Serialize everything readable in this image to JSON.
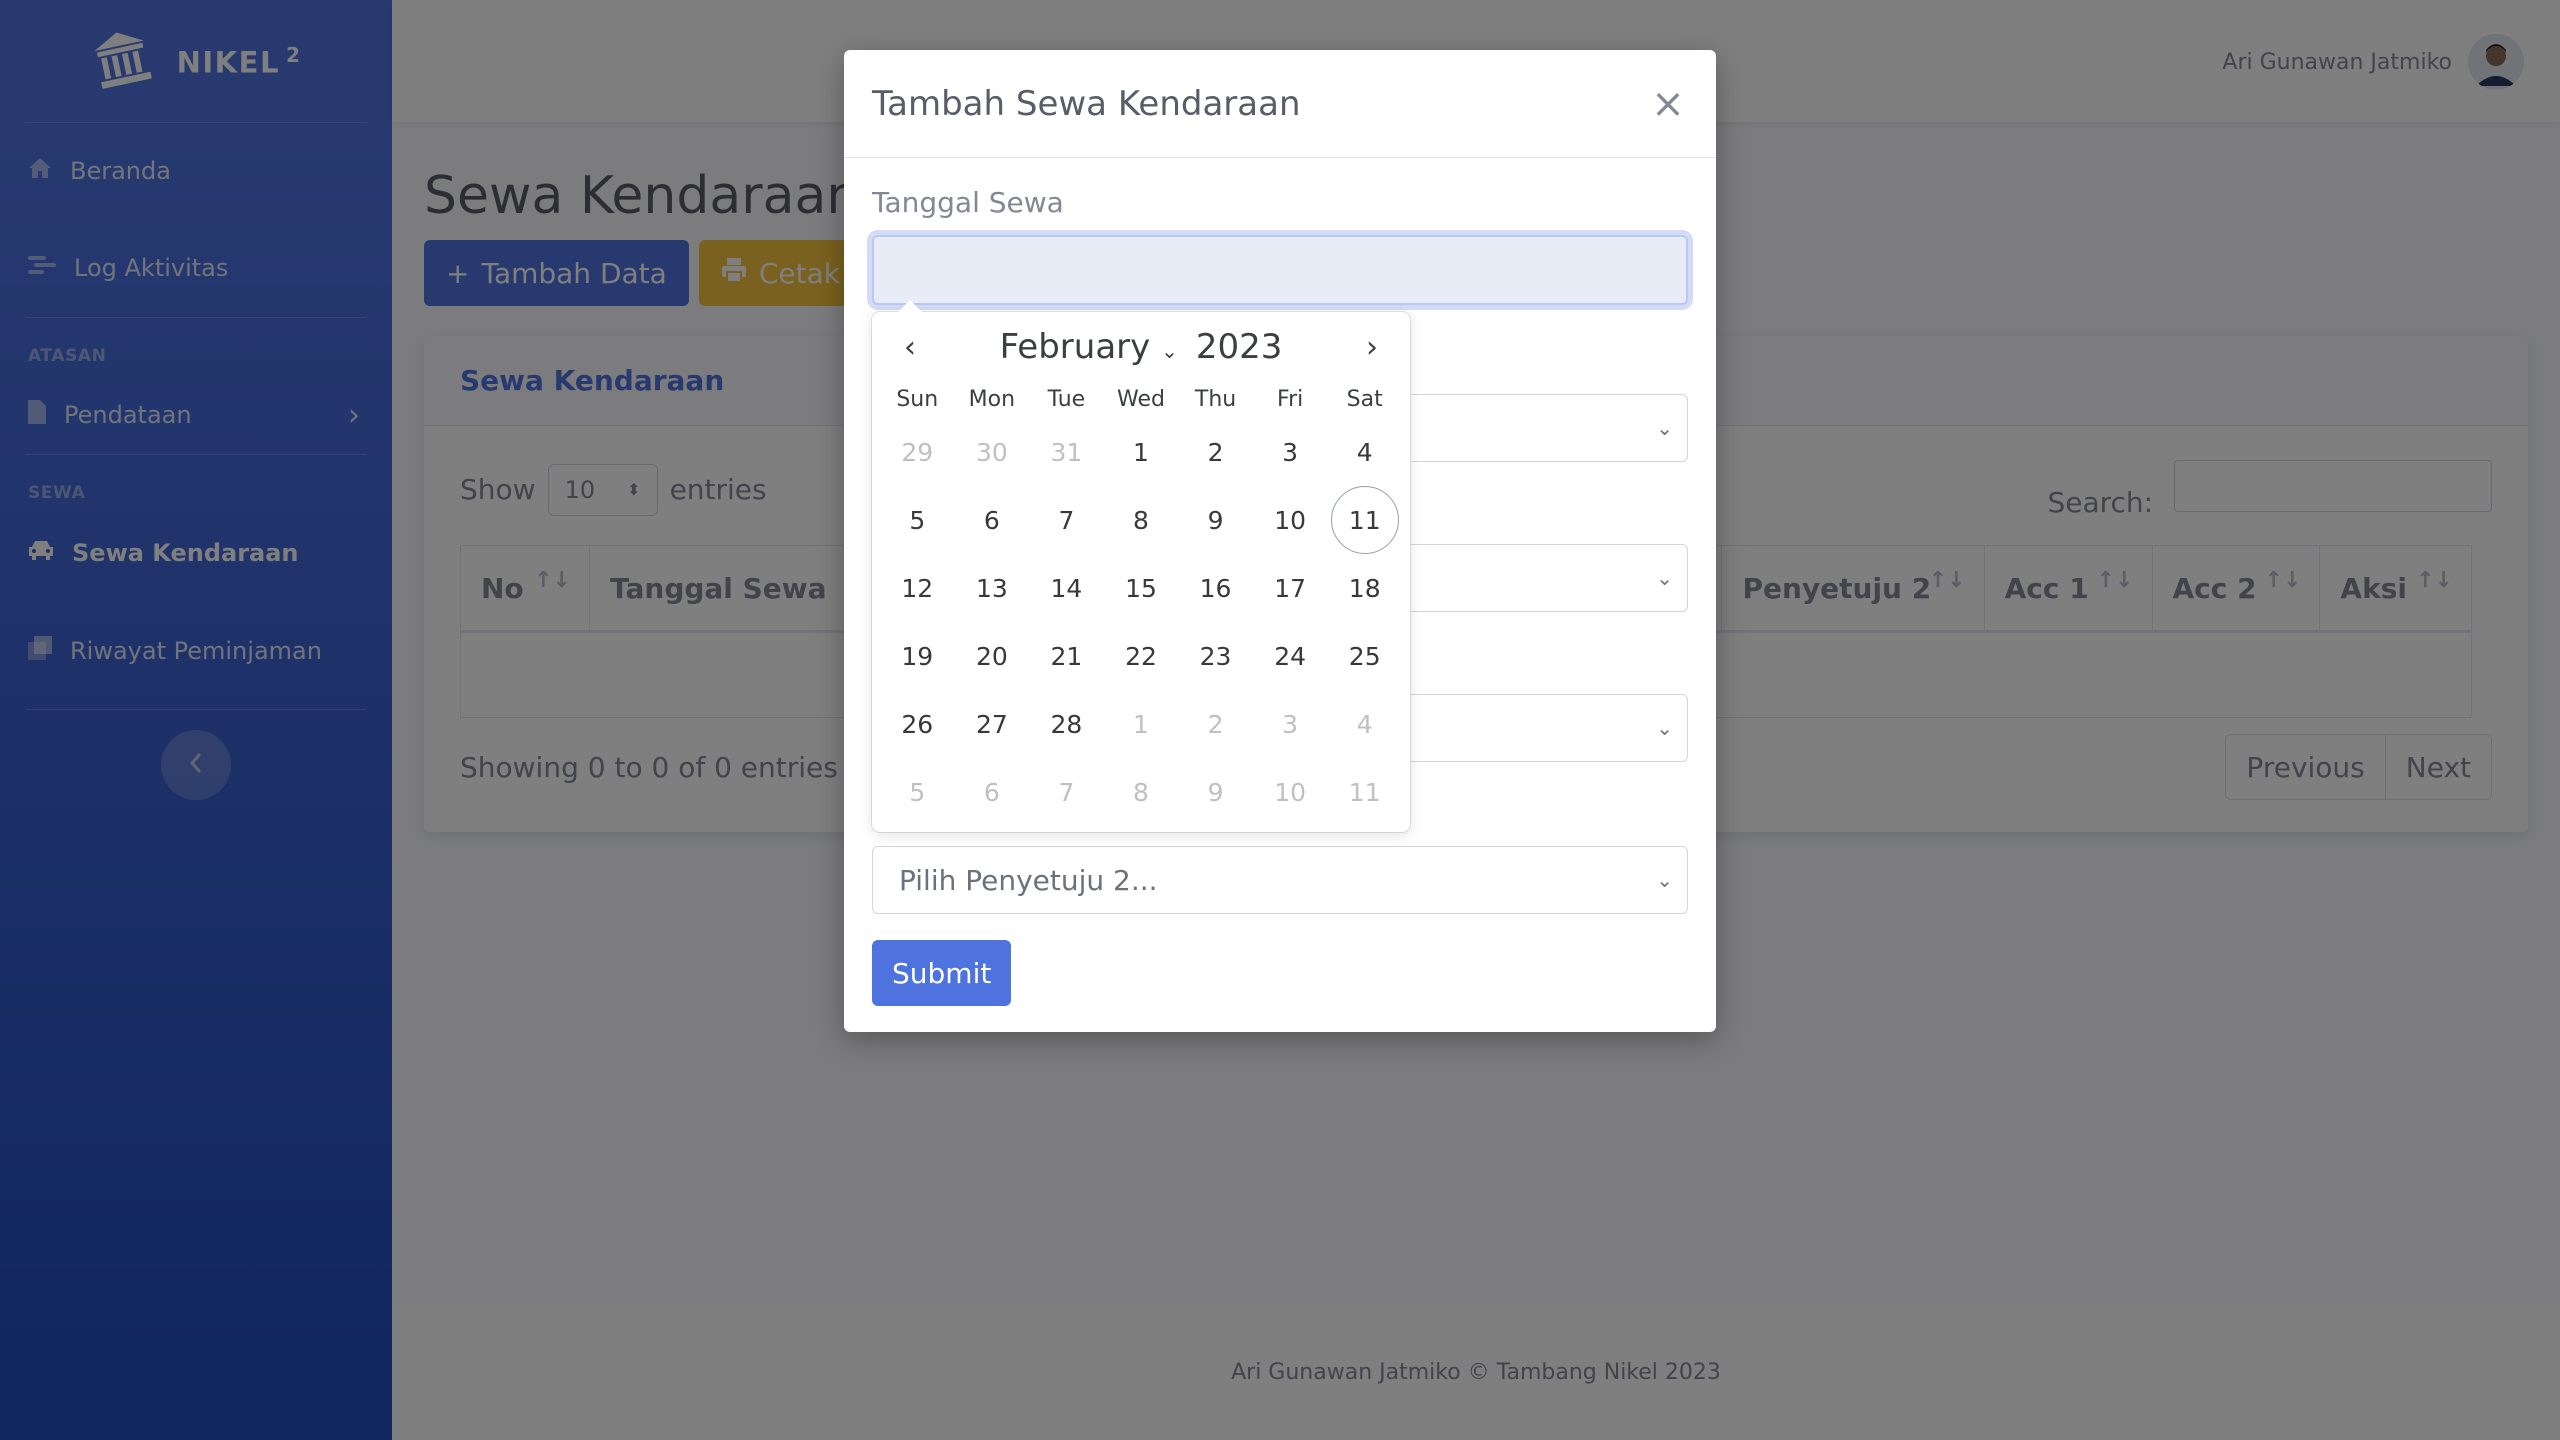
{
  "sidebar": {
    "brand": "NIKEL",
    "brand_sup": "2",
    "items": [
      {
        "label": "Beranda"
      },
      {
        "label": "Log Aktivitas"
      }
    ],
    "heading_atasan": "ATASAN",
    "pendataan": "Pendataan",
    "heading_sewa": "SEWA",
    "sewa_kendaraan": "Sewa Kendaraan",
    "riwayat": "Riwayat Peminjaman"
  },
  "topbar": {
    "user_name": "Ari Gunawan Jatmiko"
  },
  "main": {
    "page_title": "Sewa Kendaraan",
    "btn_add": "Tambah Data",
    "btn_print": "Cetak D",
    "card_title": "Sewa Kendaraan",
    "show_label": "Show",
    "entries_value": "10",
    "entries_label": "entries",
    "search_label": "Search:",
    "columns": [
      "No",
      "Tanggal Sewa",
      "Penyetuju 2",
      "Acc 1",
      "Acc 2",
      "Aksi"
    ],
    "info": "Showing 0 to 0 of 0 entries",
    "prev": "Previous",
    "next": "Next"
  },
  "footer": "Ari Gunawan Jatmiko © Tambang Nikel 2023",
  "modal": {
    "title": "Tambah Sewa Kendaraan",
    "close": "×",
    "date_label": "Tanggal Sewa",
    "select_penyetuju2": "Pilih Penyetuju 2...",
    "submit": "Submit"
  },
  "calendar": {
    "month": "February",
    "year": "2023",
    "weekdays": [
      "Sun",
      "Mon",
      "Tue",
      "Wed",
      "Thu",
      "Fri",
      "Sat"
    ],
    "days": [
      {
        "d": "29",
        "m": true
      },
      {
        "d": "30",
        "m": true
      },
      {
        "d": "31",
        "m": true
      },
      {
        "d": "1"
      },
      {
        "d": "2"
      },
      {
        "d": "3"
      },
      {
        "d": "4"
      },
      {
        "d": "5"
      },
      {
        "d": "6"
      },
      {
        "d": "7"
      },
      {
        "d": "8"
      },
      {
        "d": "9"
      },
      {
        "d": "10"
      },
      {
        "d": "11",
        "t": true
      },
      {
        "d": "12"
      },
      {
        "d": "13"
      },
      {
        "d": "14"
      },
      {
        "d": "15"
      },
      {
        "d": "16"
      },
      {
        "d": "17"
      },
      {
        "d": "18"
      },
      {
        "d": "19"
      },
      {
        "d": "20"
      },
      {
        "d": "21"
      },
      {
        "d": "22"
      },
      {
        "d": "23"
      },
      {
        "d": "24"
      },
      {
        "d": "25"
      },
      {
        "d": "26"
      },
      {
        "d": "27"
      },
      {
        "d": "28"
      },
      {
        "d": "1",
        "m": true
      },
      {
        "d": "2",
        "m": true
      },
      {
        "d": "3",
        "m": true
      },
      {
        "d": "4",
        "m": true
      },
      {
        "d": "5",
        "m": true
      },
      {
        "d": "6",
        "m": true
      },
      {
        "d": "7",
        "m": true
      },
      {
        "d": "8",
        "m": true
      },
      {
        "d": "9",
        "m": true
      },
      {
        "d": "10",
        "m": true
      },
      {
        "d": "11",
        "m": true
      }
    ]
  }
}
